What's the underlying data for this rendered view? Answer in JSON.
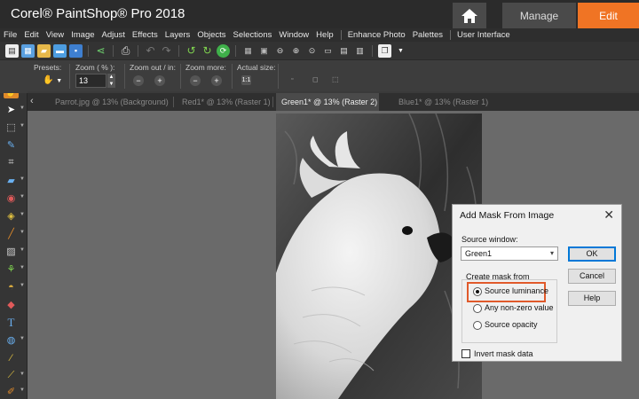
{
  "app": {
    "title": "Corel® PaintShop® Pro 2018"
  },
  "workspace_tabs": {
    "manage": "Manage",
    "edit": "Edit"
  },
  "menu": [
    "File",
    "Edit",
    "View",
    "Image",
    "Adjust",
    "Effects",
    "Layers",
    "Objects",
    "Selections",
    "Window",
    "Help",
    "Enhance Photo",
    "Palettes",
    "User Interface"
  ],
  "tool_options": {
    "presets_label": "Presets:",
    "zoom_label": "Zoom ( % ):",
    "zoom_value": "13",
    "zoom_out_in_label": "Zoom out / in:",
    "zoom_more_label": "Zoom more:",
    "actual_size_label": "Actual size:"
  },
  "doc_tabs": [
    {
      "label": "Parrot.jpg @  13% (Background)",
      "active": false
    },
    {
      "label": "Red1* @  13% (Raster 1)",
      "active": false
    },
    {
      "label": "Green1* @  13% (Raster 2)",
      "active": true
    },
    {
      "label": "Blue1* @  13% (Raster 1)",
      "active": false
    }
  ],
  "dialog": {
    "title": "Add Mask From Image",
    "close": "✕",
    "source_window_label": "Source window:",
    "source_window_value": "Green1",
    "create_mask_label": "Create mask from",
    "option_luminance": "Source luminance",
    "option_nonzero": "Any non-zero value",
    "option_opacity": "Source opacity",
    "selected_option": "Source luminance",
    "invert_label": "Invert mask data",
    "invert_checked": false,
    "ok": "OK",
    "cancel": "Cancel",
    "help": "Help"
  },
  "colors": {
    "edit_tab": "#f07424",
    "highlight": "#e05a2b",
    "ok_border": "#0078d7"
  }
}
